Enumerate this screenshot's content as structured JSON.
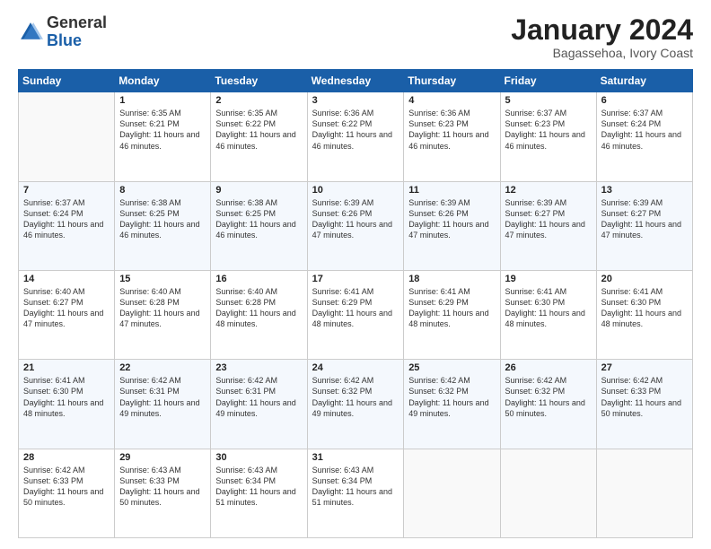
{
  "header": {
    "logo_general": "General",
    "logo_blue": "Blue",
    "month_year": "January 2024",
    "location": "Bagassehoa, Ivory Coast"
  },
  "days_of_week": [
    "Sunday",
    "Monday",
    "Tuesday",
    "Wednesday",
    "Thursday",
    "Friday",
    "Saturday"
  ],
  "weeks": [
    [
      {
        "day": "",
        "info": ""
      },
      {
        "day": "1",
        "info": "Sunrise: 6:35 AM\nSunset: 6:21 PM\nDaylight: 11 hours and 46 minutes."
      },
      {
        "day": "2",
        "info": "Sunrise: 6:35 AM\nSunset: 6:22 PM\nDaylight: 11 hours and 46 minutes."
      },
      {
        "day": "3",
        "info": "Sunrise: 6:36 AM\nSunset: 6:22 PM\nDaylight: 11 hours and 46 minutes."
      },
      {
        "day": "4",
        "info": "Sunrise: 6:36 AM\nSunset: 6:23 PM\nDaylight: 11 hours and 46 minutes."
      },
      {
        "day": "5",
        "info": "Sunrise: 6:37 AM\nSunset: 6:23 PM\nDaylight: 11 hours and 46 minutes."
      },
      {
        "day": "6",
        "info": "Sunrise: 6:37 AM\nSunset: 6:24 PM\nDaylight: 11 hours and 46 minutes."
      }
    ],
    [
      {
        "day": "7",
        "info": "Sunrise: 6:37 AM\nSunset: 6:24 PM\nDaylight: 11 hours and 46 minutes."
      },
      {
        "day": "8",
        "info": "Sunrise: 6:38 AM\nSunset: 6:25 PM\nDaylight: 11 hours and 46 minutes."
      },
      {
        "day": "9",
        "info": "Sunrise: 6:38 AM\nSunset: 6:25 PM\nDaylight: 11 hours and 46 minutes."
      },
      {
        "day": "10",
        "info": "Sunrise: 6:39 AM\nSunset: 6:26 PM\nDaylight: 11 hours and 47 minutes."
      },
      {
        "day": "11",
        "info": "Sunrise: 6:39 AM\nSunset: 6:26 PM\nDaylight: 11 hours and 47 minutes."
      },
      {
        "day": "12",
        "info": "Sunrise: 6:39 AM\nSunset: 6:27 PM\nDaylight: 11 hours and 47 minutes."
      },
      {
        "day": "13",
        "info": "Sunrise: 6:39 AM\nSunset: 6:27 PM\nDaylight: 11 hours and 47 minutes."
      }
    ],
    [
      {
        "day": "14",
        "info": "Sunrise: 6:40 AM\nSunset: 6:27 PM\nDaylight: 11 hours and 47 minutes."
      },
      {
        "day": "15",
        "info": "Sunrise: 6:40 AM\nSunset: 6:28 PM\nDaylight: 11 hours and 47 minutes."
      },
      {
        "day": "16",
        "info": "Sunrise: 6:40 AM\nSunset: 6:28 PM\nDaylight: 11 hours and 48 minutes."
      },
      {
        "day": "17",
        "info": "Sunrise: 6:41 AM\nSunset: 6:29 PM\nDaylight: 11 hours and 48 minutes."
      },
      {
        "day": "18",
        "info": "Sunrise: 6:41 AM\nSunset: 6:29 PM\nDaylight: 11 hours and 48 minutes."
      },
      {
        "day": "19",
        "info": "Sunrise: 6:41 AM\nSunset: 6:30 PM\nDaylight: 11 hours and 48 minutes."
      },
      {
        "day": "20",
        "info": "Sunrise: 6:41 AM\nSunset: 6:30 PM\nDaylight: 11 hours and 48 minutes."
      }
    ],
    [
      {
        "day": "21",
        "info": "Sunrise: 6:41 AM\nSunset: 6:30 PM\nDaylight: 11 hours and 48 minutes."
      },
      {
        "day": "22",
        "info": "Sunrise: 6:42 AM\nSunset: 6:31 PM\nDaylight: 11 hours and 49 minutes."
      },
      {
        "day": "23",
        "info": "Sunrise: 6:42 AM\nSunset: 6:31 PM\nDaylight: 11 hours and 49 minutes."
      },
      {
        "day": "24",
        "info": "Sunrise: 6:42 AM\nSunset: 6:32 PM\nDaylight: 11 hours and 49 minutes."
      },
      {
        "day": "25",
        "info": "Sunrise: 6:42 AM\nSunset: 6:32 PM\nDaylight: 11 hours and 49 minutes."
      },
      {
        "day": "26",
        "info": "Sunrise: 6:42 AM\nSunset: 6:32 PM\nDaylight: 11 hours and 50 minutes."
      },
      {
        "day": "27",
        "info": "Sunrise: 6:42 AM\nSunset: 6:33 PM\nDaylight: 11 hours and 50 minutes."
      }
    ],
    [
      {
        "day": "28",
        "info": "Sunrise: 6:42 AM\nSunset: 6:33 PM\nDaylight: 11 hours and 50 minutes."
      },
      {
        "day": "29",
        "info": "Sunrise: 6:43 AM\nSunset: 6:33 PM\nDaylight: 11 hours and 50 minutes."
      },
      {
        "day": "30",
        "info": "Sunrise: 6:43 AM\nSunset: 6:34 PM\nDaylight: 11 hours and 51 minutes."
      },
      {
        "day": "31",
        "info": "Sunrise: 6:43 AM\nSunset: 6:34 PM\nDaylight: 11 hours and 51 minutes."
      },
      {
        "day": "",
        "info": ""
      },
      {
        "day": "",
        "info": ""
      },
      {
        "day": "",
        "info": ""
      }
    ]
  ]
}
